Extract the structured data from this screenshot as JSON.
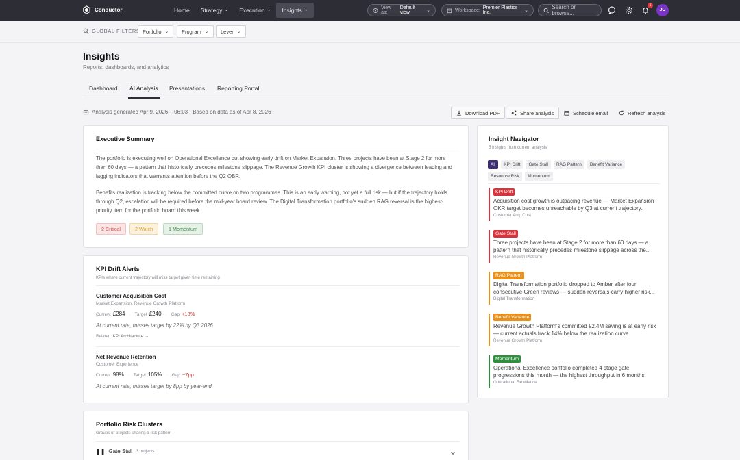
{
  "app": {
    "brand": "Conductor"
  },
  "nav": {
    "items": [
      {
        "label": "Home",
        "chevron": false,
        "active": false
      },
      {
        "label": "Strategy",
        "chevron": true,
        "active": false
      },
      {
        "label": "Execution",
        "chevron": true,
        "active": false
      },
      {
        "label": "Insights",
        "chevron": true,
        "active": true
      }
    ],
    "view_as_label": "View as:",
    "view_as_value": "Default view",
    "workspace_label": "Workspace:",
    "workspace_value": "Premier Plastics Inc.",
    "search_placeholder": "Search or browse...",
    "notification_count": "5",
    "avatar_initials": "JC"
  },
  "filters": {
    "label": "GLOBAL FILTERS",
    "items": [
      "Portfolio",
      "Program",
      "Lever"
    ]
  },
  "page": {
    "title": "Insights",
    "subtitle": "Reports, dashboards, and analytics",
    "tabs": [
      "Dashboard",
      "AI Analysis",
      "Presentations",
      "Reporting Portal"
    ],
    "active_tab": "AI Analysis",
    "generated": "Analysis generated Apr 9, 2026 – 06:03 · Based on data as of Apr 8, 2026",
    "actions": {
      "download": "Download PDF",
      "share": "Share analysis",
      "schedule": "Schedule email",
      "refresh": "Refresh analysis"
    }
  },
  "summary": {
    "title": "Executive Summary",
    "p1": "The portfolio is executing well on Operational Excellence but showing early drift on Market Expansion. Three projects have been at Stage 2 for more than 60 days — a pattern that historically precedes milestone slippage. The Revenue Growth KPI cluster is showing a divergence between leading and lagging indicators that warrants attention before the Q2 QBR.",
    "p2": "Benefits realization is tracking below the committed curve on two programmes. This is an early warning, not yet a full risk — but if the trajectory holds through Q2, escalation will be required before the mid-year board review. The Digital Transformation portfolio's sudden RAG reversal is the highest-priority item for the portfolio board this week.",
    "chips": {
      "critical": "2 Critical",
      "watch": "2 Watch",
      "momentum": "1 Momentum"
    },
    "colors": {
      "critical": "#d9534f",
      "watch": "#e0a030",
      "momentum": "#3c8a4a"
    }
  },
  "kpi": {
    "title": "KPI Drift Alerts",
    "subtitle": "KPIs where current trajectory will miss target given time remaining",
    "current_label": "Current",
    "target_label": "Target",
    "gap_label": "Gap",
    "related_label": "Related:",
    "items": [
      {
        "name": "Customer Acquisition Cost",
        "meta": "Market Expansion, Revenue Growth Platform",
        "current": "£284",
        "target": "£240",
        "gap": "+18%",
        "note": "At current rate, misses target by 22% by Q3 2026",
        "related": "KPI Architecture →"
      },
      {
        "name": "Net Revenue Retention",
        "meta": "Customer Experience",
        "current": "98%",
        "target": "105%",
        "gap": "−7pp",
        "note": "At current rate, misses target by 8pp by year-end"
      }
    ]
  },
  "clusters": {
    "title": "Portfolio Risk Clusters",
    "subtitle": "Groups of projects sharing a risk pattern",
    "row_name": "Gate Stall",
    "row_count": "3 projects"
  },
  "navigator": {
    "title": "Insight Navigator",
    "subtitle": "5 insights from current analysis",
    "filters": [
      "All",
      "KPI Drift",
      "Gate Stall",
      "RAG Pattern",
      "Benefit Variance",
      "Resource Risk",
      "Momentum"
    ],
    "insights": [
      {
        "tag": "KPI Drift",
        "color": "#d9343c",
        "text": "Acquisition cost growth is outpacing revenue — Market Expansion OKR target becomes unreachable by Q3 at current trajectory.",
        "source": "Customer Acq. Cost"
      },
      {
        "tag": "Gate Stall",
        "color": "#d9343c",
        "text": "Three projects have been at Stage 2 for more than 60 days — a pattern that historically precedes milestone slippage across the...",
        "source": "Revenue Growth Platform"
      },
      {
        "tag": "RAG Pattern",
        "color": "#e8901c",
        "text": "Digital Transformation portfolio dropped to Amber after four consecutive Green reviews — sudden reversals carry higher risk...",
        "source": "Digital Transformation"
      },
      {
        "tag": "Benefit Variance",
        "color": "#e8901c",
        "text": "Revenue Growth Platform's committed £2.4M saving is at early risk — current actuals track 14% below the realization curve.",
        "source": "Revenue Growth Platform"
      },
      {
        "tag": "Momentum",
        "color": "#2f8f3e",
        "text": "Operational Excellence portfolio completed 4 stage gate progressions this month — the highest throughput in 6 months.",
        "source": "Operational Excellence"
      }
    ]
  }
}
